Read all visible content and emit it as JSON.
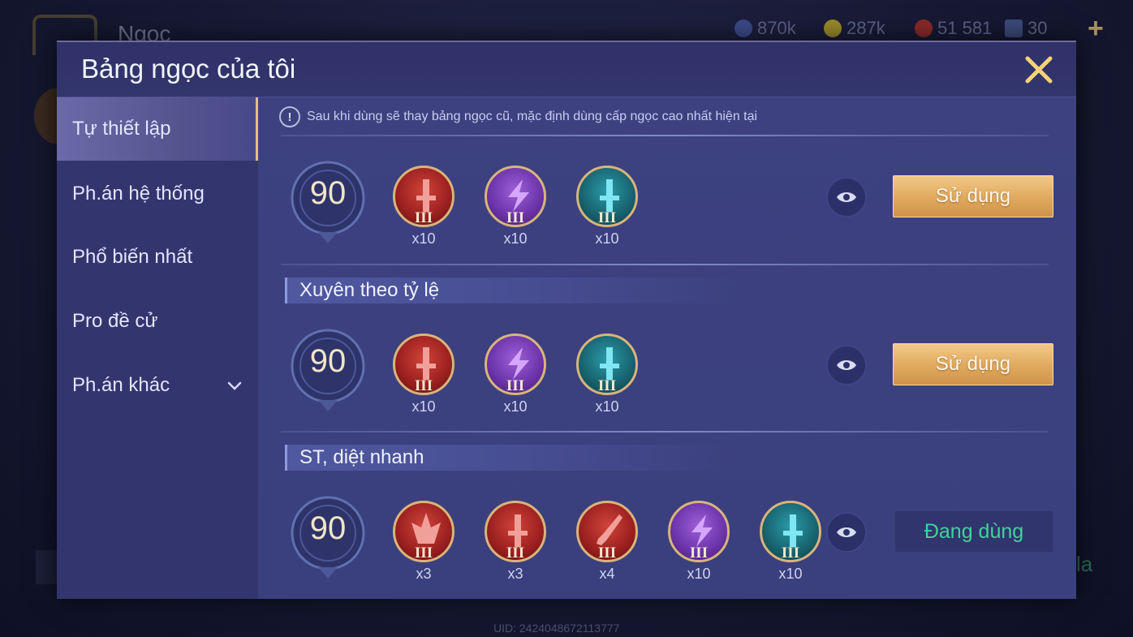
{
  "background": {
    "title": "Ngọc",
    "currencies": [
      {
        "icon": "blue-gem-icon",
        "value": "870k",
        "color": "#3c4a8a"
      },
      {
        "icon": "gold-coin-icon",
        "value": "287k",
        "color": "#9a8a2a"
      },
      {
        "icon": "red-gem-icon",
        "value": "51 581",
        "color": "#8a2a2a"
      },
      {
        "icon": "card-icon",
        "value": "30",
        "color": "#3a4a7a"
      }
    ],
    "uid": "UID: 2424048672113777",
    "partial_text": "la"
  },
  "modal": {
    "title": "Bảng ngọc của tôi",
    "close_icon": "close-icon"
  },
  "sidebar": {
    "items": [
      {
        "label": "Tự thiết lập",
        "active": true
      },
      {
        "label": "Ph.án hệ thống",
        "active": false
      },
      {
        "label": "Phổ biến nhất",
        "active": false
      },
      {
        "label": "Pro đề cử",
        "active": false
      },
      {
        "label": "Ph.án khác",
        "active": false,
        "has_dropdown": true
      }
    ]
  },
  "notice": "Sau khi dùng sẽ thay bảng ngọc cũ, mặc định dùng cấp ngọc cao nhất hiện tại",
  "sets": [
    {
      "name": "",
      "level": "90",
      "gems": [
        {
          "color": "red",
          "shape": "sword",
          "tier": "III",
          "count": "x10"
        },
        {
          "color": "purple",
          "shape": "bolt",
          "tier": "III",
          "count": "x10"
        },
        {
          "color": "teal",
          "shape": "sword",
          "tier": "III",
          "count": "x10"
        }
      ],
      "action": "Sử dụng",
      "in_use": false
    },
    {
      "name": "Xuyên theo tỷ lệ",
      "level": "90",
      "gems": [
        {
          "color": "red",
          "shape": "sword",
          "tier": "III",
          "count": "x10"
        },
        {
          "color": "purple",
          "shape": "bolt",
          "tier": "III",
          "count": "x10"
        },
        {
          "color": "teal",
          "shape": "sword",
          "tier": "III",
          "count": "x10"
        }
      ],
      "action": "Sử dụng",
      "in_use": false
    },
    {
      "name": "ST, diệt nhanh",
      "level": "90",
      "gems": [
        {
          "color": "red",
          "shape": "crown",
          "tier": "III",
          "count": "x3"
        },
        {
          "color": "red",
          "shape": "sword",
          "tier": "III",
          "count": "x3"
        },
        {
          "color": "red",
          "shape": "blade",
          "tier": "III",
          "count": "x4"
        },
        {
          "color": "purple",
          "shape": "bolt",
          "tier": "III",
          "count": "x10"
        },
        {
          "color": "teal",
          "shape": "sword",
          "tier": "III",
          "count": "x10"
        }
      ],
      "action": "Đang dùng",
      "in_use": true
    }
  ]
}
